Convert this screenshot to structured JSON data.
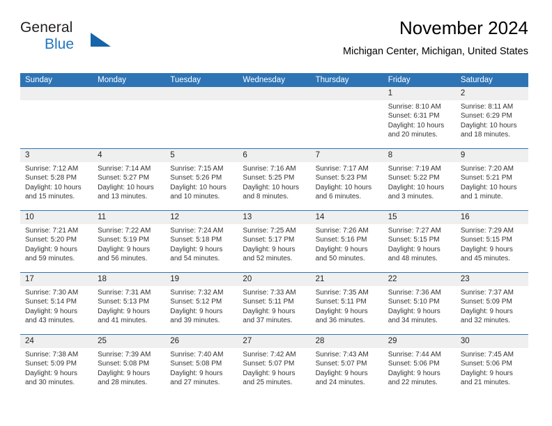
{
  "brand": {
    "name_part1": "General",
    "name_part2": "Blue",
    "logo_icon": "triangle-flag-icon"
  },
  "header": {
    "title": "November 2024",
    "location": "Michigan Center, Michigan, United States"
  },
  "colors": {
    "header_blue": "#2e74b5",
    "band_gray": "#efefef",
    "brand_blue": "#2175bc",
    "text": "#000000"
  },
  "weekdays": [
    "Sunday",
    "Monday",
    "Tuesday",
    "Wednesday",
    "Thursday",
    "Friday",
    "Saturday"
  ],
  "labels": {
    "sunrise": "Sunrise:",
    "sunset": "Sunset:",
    "daylight": "Daylight:"
  },
  "weeks": [
    [
      {
        "day": "",
        "empty": true
      },
      {
        "day": "",
        "empty": true
      },
      {
        "day": "",
        "empty": true
      },
      {
        "day": "",
        "empty": true
      },
      {
        "day": "",
        "empty": true
      },
      {
        "day": "1",
        "sunrise": "Sunrise: 8:10 AM",
        "sunset": "Sunset: 6:31 PM",
        "daylight": "Daylight: 10 hours and 20 minutes."
      },
      {
        "day": "2",
        "sunrise": "Sunrise: 8:11 AM",
        "sunset": "Sunset: 6:29 PM",
        "daylight": "Daylight: 10 hours and 18 minutes."
      }
    ],
    [
      {
        "day": "3",
        "sunrise": "Sunrise: 7:12 AM",
        "sunset": "Sunset: 5:28 PM",
        "daylight": "Daylight: 10 hours and 15 minutes."
      },
      {
        "day": "4",
        "sunrise": "Sunrise: 7:14 AM",
        "sunset": "Sunset: 5:27 PM",
        "daylight": "Daylight: 10 hours and 13 minutes."
      },
      {
        "day": "5",
        "sunrise": "Sunrise: 7:15 AM",
        "sunset": "Sunset: 5:26 PM",
        "daylight": "Daylight: 10 hours and 10 minutes."
      },
      {
        "day": "6",
        "sunrise": "Sunrise: 7:16 AM",
        "sunset": "Sunset: 5:25 PM",
        "daylight": "Daylight: 10 hours and 8 minutes."
      },
      {
        "day": "7",
        "sunrise": "Sunrise: 7:17 AM",
        "sunset": "Sunset: 5:23 PM",
        "daylight": "Daylight: 10 hours and 6 minutes."
      },
      {
        "day": "8",
        "sunrise": "Sunrise: 7:19 AM",
        "sunset": "Sunset: 5:22 PM",
        "daylight": "Daylight: 10 hours and 3 minutes."
      },
      {
        "day": "9",
        "sunrise": "Sunrise: 7:20 AM",
        "sunset": "Sunset: 5:21 PM",
        "daylight": "Daylight: 10 hours and 1 minute."
      }
    ],
    [
      {
        "day": "10",
        "sunrise": "Sunrise: 7:21 AM",
        "sunset": "Sunset: 5:20 PM",
        "daylight": "Daylight: 9 hours and 59 minutes."
      },
      {
        "day": "11",
        "sunrise": "Sunrise: 7:22 AM",
        "sunset": "Sunset: 5:19 PM",
        "daylight": "Daylight: 9 hours and 56 minutes."
      },
      {
        "day": "12",
        "sunrise": "Sunrise: 7:24 AM",
        "sunset": "Sunset: 5:18 PM",
        "daylight": "Daylight: 9 hours and 54 minutes."
      },
      {
        "day": "13",
        "sunrise": "Sunrise: 7:25 AM",
        "sunset": "Sunset: 5:17 PM",
        "daylight": "Daylight: 9 hours and 52 minutes."
      },
      {
        "day": "14",
        "sunrise": "Sunrise: 7:26 AM",
        "sunset": "Sunset: 5:16 PM",
        "daylight": "Daylight: 9 hours and 50 minutes."
      },
      {
        "day": "15",
        "sunrise": "Sunrise: 7:27 AM",
        "sunset": "Sunset: 5:15 PM",
        "daylight": "Daylight: 9 hours and 48 minutes."
      },
      {
        "day": "16",
        "sunrise": "Sunrise: 7:29 AM",
        "sunset": "Sunset: 5:15 PM",
        "daylight": "Daylight: 9 hours and 45 minutes."
      }
    ],
    [
      {
        "day": "17",
        "sunrise": "Sunrise: 7:30 AM",
        "sunset": "Sunset: 5:14 PM",
        "daylight": "Daylight: 9 hours and 43 minutes."
      },
      {
        "day": "18",
        "sunrise": "Sunrise: 7:31 AM",
        "sunset": "Sunset: 5:13 PM",
        "daylight": "Daylight: 9 hours and 41 minutes."
      },
      {
        "day": "19",
        "sunrise": "Sunrise: 7:32 AM",
        "sunset": "Sunset: 5:12 PM",
        "daylight": "Daylight: 9 hours and 39 minutes."
      },
      {
        "day": "20",
        "sunrise": "Sunrise: 7:33 AM",
        "sunset": "Sunset: 5:11 PM",
        "daylight": "Daylight: 9 hours and 37 minutes."
      },
      {
        "day": "21",
        "sunrise": "Sunrise: 7:35 AM",
        "sunset": "Sunset: 5:11 PM",
        "daylight": "Daylight: 9 hours and 36 minutes."
      },
      {
        "day": "22",
        "sunrise": "Sunrise: 7:36 AM",
        "sunset": "Sunset: 5:10 PM",
        "daylight": "Daylight: 9 hours and 34 minutes."
      },
      {
        "day": "23",
        "sunrise": "Sunrise: 7:37 AM",
        "sunset": "Sunset: 5:09 PM",
        "daylight": "Daylight: 9 hours and 32 minutes."
      }
    ],
    [
      {
        "day": "24",
        "sunrise": "Sunrise: 7:38 AM",
        "sunset": "Sunset: 5:09 PM",
        "daylight": "Daylight: 9 hours and 30 minutes."
      },
      {
        "day": "25",
        "sunrise": "Sunrise: 7:39 AM",
        "sunset": "Sunset: 5:08 PM",
        "daylight": "Daylight: 9 hours and 28 minutes."
      },
      {
        "day": "26",
        "sunrise": "Sunrise: 7:40 AM",
        "sunset": "Sunset: 5:08 PM",
        "daylight": "Daylight: 9 hours and 27 minutes."
      },
      {
        "day": "27",
        "sunrise": "Sunrise: 7:42 AM",
        "sunset": "Sunset: 5:07 PM",
        "daylight": "Daylight: 9 hours and 25 minutes."
      },
      {
        "day": "28",
        "sunrise": "Sunrise: 7:43 AM",
        "sunset": "Sunset: 5:07 PM",
        "daylight": "Daylight: 9 hours and 24 minutes."
      },
      {
        "day": "29",
        "sunrise": "Sunrise: 7:44 AM",
        "sunset": "Sunset: 5:06 PM",
        "daylight": "Daylight: 9 hours and 22 minutes."
      },
      {
        "day": "30",
        "sunrise": "Sunrise: 7:45 AM",
        "sunset": "Sunset: 5:06 PM",
        "daylight": "Daylight: 9 hours and 21 minutes."
      }
    ]
  ]
}
